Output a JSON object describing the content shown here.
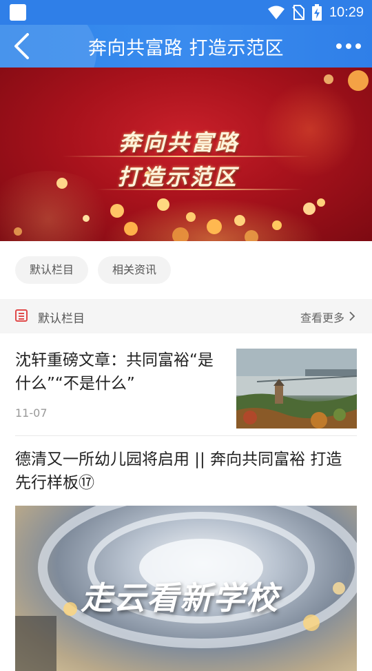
{
  "status_bar": {
    "time": "10:29"
  },
  "header": {
    "title": "奔向共富路 打造示范区"
  },
  "banner": {
    "line1": "奔向共富路",
    "line2": "打造示范区"
  },
  "tabs": [
    {
      "label": "默认栏目"
    },
    {
      "label": "相关资讯"
    }
  ],
  "section": {
    "label": "默认栏目",
    "more_label": "查看更多"
  },
  "articles": [
    {
      "title": "沈轩重磅文章：共同富裕“是什么”“不是什么”",
      "date": "11-07"
    },
    {
      "title": "德清又一所幼儿园将启用 || 奔向共同富裕 打造先行样板⑰",
      "image_caption": "走云看新学校"
    }
  ],
  "colors": {
    "header_blue": "#2f7fe8",
    "banner_red": "#a8121c",
    "accent_red": "#e04a4a"
  }
}
